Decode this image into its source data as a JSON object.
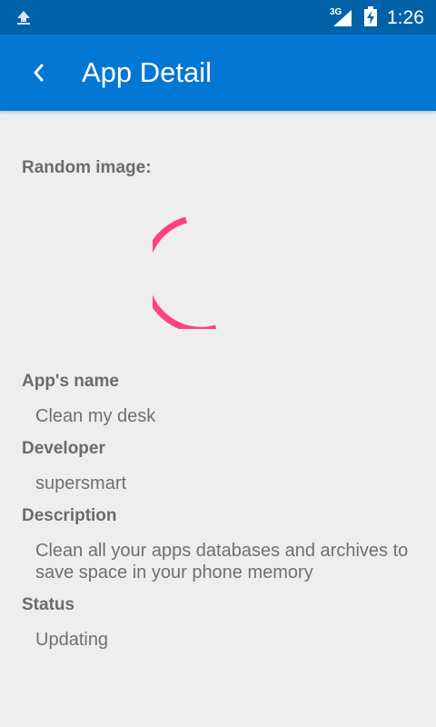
{
  "status_bar": {
    "network_type": "3G",
    "time": "1:26",
    "icons": [
      "upload-icon",
      "signal-icon",
      "battery-charging-icon"
    ]
  },
  "app_bar": {
    "back_icon": "chevron-left-icon",
    "title": "App Detail"
  },
  "detail": {
    "image_label": "Random image:",
    "name_label": "App's name",
    "name_value": "Clean my desk",
    "developer_label": "Developer",
    "developer_value": "supersmart",
    "description_label": "Description",
    "description_value": "Clean all your apps databases and archives to save space in your phone  memory",
    "status_label": "Status",
    "status_value": "Updating"
  },
  "colors": {
    "status_bar": "#0162a8",
    "app_bar": "#0277d4",
    "background": "#eeeeee",
    "spinner": "#ff4081"
  }
}
